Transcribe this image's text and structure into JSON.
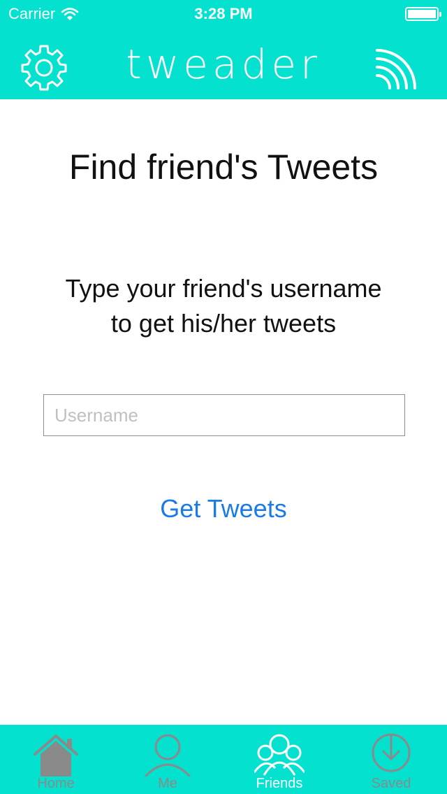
{
  "status_bar": {
    "carrier": "Carrier",
    "time": "3:28 PM"
  },
  "nav": {
    "title": "tweader",
    "left_icon": "gear-icon",
    "right_icon": "rss-feed-icon"
  },
  "content": {
    "title": "Find friend's Tweets",
    "instruction_line1": "Type your friend's username",
    "instruction_line2": "to get his/her tweets",
    "username_placeholder": "Username",
    "username_value": "",
    "button_label": "Get Tweets"
  },
  "tab_bar": {
    "tabs": [
      {
        "label": "Home",
        "icon": "home-icon",
        "active": false
      },
      {
        "label": "Me",
        "icon": "person-icon",
        "active": false
      },
      {
        "label": "Friends",
        "icon": "friends-icon",
        "active": true
      },
      {
        "label": "Saved",
        "icon": "download-icon",
        "active": false
      }
    ]
  },
  "colors": {
    "brand": "#05e1cf",
    "link": "#1a7be6",
    "inactive_tab": "#8a8a8a",
    "active_tab": "#ffffff"
  }
}
